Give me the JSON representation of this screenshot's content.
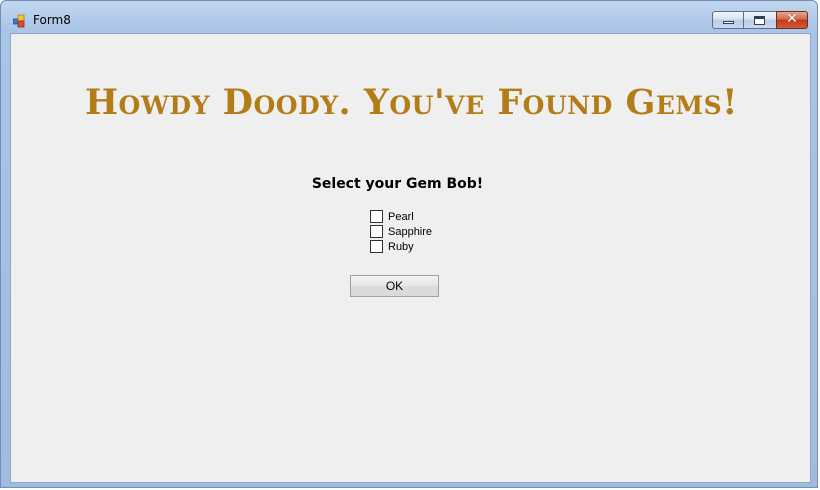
{
  "window": {
    "title": "Form8",
    "icons": {
      "app": "app-window-icon",
      "minimize": "minimize-icon",
      "maximize": "maximize-icon",
      "close": "close-icon"
    },
    "close_glyph": "✕"
  },
  "form": {
    "heading": "Howdy Doody. You've Found Gems!",
    "prompt": "Select your Gem Bob!",
    "options": [
      {
        "label": "Pearl",
        "checked": false
      },
      {
        "label": "Sapphire",
        "checked": false
      },
      {
        "label": "Ruby",
        "checked": false
      }
    ],
    "ok_label": "OK"
  },
  "colors": {
    "heading": "#b27d19",
    "client_background": "#f0efef",
    "title_bar": "#a9c4e6"
  }
}
